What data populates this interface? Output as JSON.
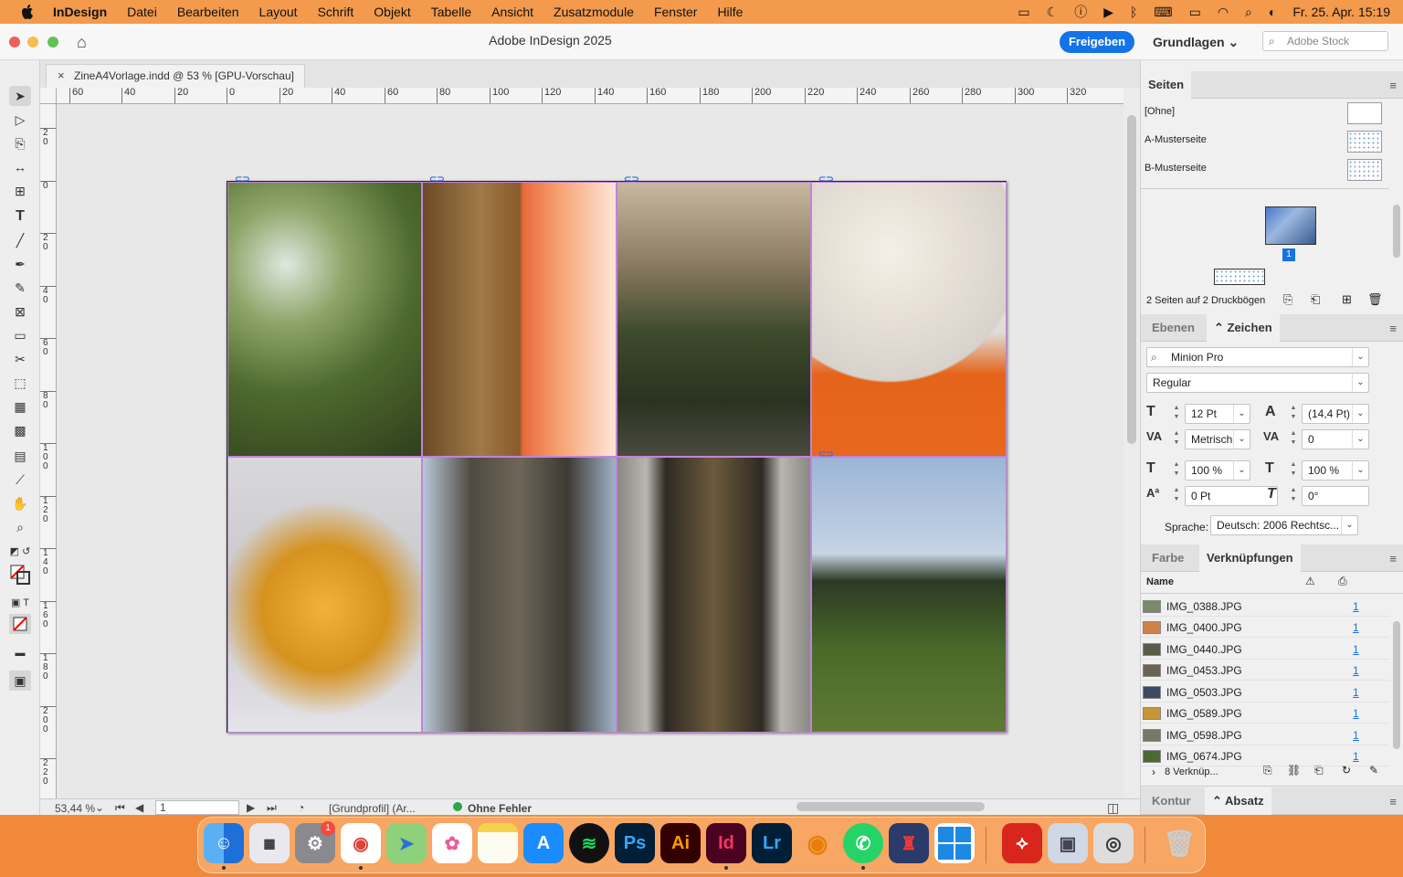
{
  "menubar": {
    "app": "InDesign",
    "items": [
      "Datei",
      "Bearbeiten",
      "Layout",
      "Schrift",
      "Objekt",
      "Tabelle",
      "Ansicht",
      "Zusatzmodule",
      "Fenster",
      "Hilfe"
    ],
    "datetime": "Fr. 25. Apr.  15:19"
  },
  "window": {
    "title": "Adobe InDesign 2025",
    "share_label": "Freigeben",
    "workspace": "Grundlagen",
    "stock_placeholder": "Adobe Stock"
  },
  "document": {
    "tab_label": "ZineA4Vorlage.indd @ 53 % [GPU-Vorschau]"
  },
  "ruler": {
    "h": [
      "60",
      "40",
      "20",
      "0",
      "20",
      "40",
      "60",
      "80",
      "100",
      "120",
      "140",
      "160",
      "180",
      "200",
      "220",
      "240",
      "260",
      "280",
      "300",
      "320"
    ],
    "v": [
      "2\n0",
      "0",
      "2\n0",
      "4\n0",
      "6\n0",
      "8\n0",
      "1\n0\n0",
      "1\n2\n0",
      "1\n4\n0",
      "1\n6\n0",
      "1\n8\n0",
      "2\n0\n0",
      "2\n2\n0"
    ]
  },
  "status": {
    "zoom": "53,44 %",
    "page": "1",
    "profile": "[Grundprofil] (Ar...",
    "errors": "Ohne Fehler"
  },
  "pages_panel": {
    "tab": "Seiten",
    "masters": [
      "[Ohne]",
      "A-Musterseite",
      "B-Musterseite"
    ],
    "page_number": "1",
    "summary": "2 Seiten auf 2 Druckbögen"
  },
  "char_panel": {
    "tabs": [
      "Ebenen",
      "Zeichen"
    ],
    "font": "Minion Pro",
    "style": "Regular",
    "size": "12 Pt",
    "leading": "(14,4 Pt)",
    "kerning": "Metrisch",
    "tracking": "0",
    "vscale": "100 %",
    "hscale": "100 %",
    "baseline": "0 Pt",
    "skew": "0°",
    "language_label": "Sprache:",
    "language": "Deutsch: 2006 Rechtsc..."
  },
  "links_panel": {
    "tabs": [
      "Farbe",
      "Verknüpfungen"
    ],
    "col_name": "Name",
    "rows": [
      {
        "name": "IMG_0388.JPG",
        "page": "1"
      },
      {
        "name": "IMG_0400.JPG",
        "page": "1"
      },
      {
        "name": "IMG_0440.JPG",
        "page": "1"
      },
      {
        "name": "IMG_0453.JPG",
        "page": "1"
      },
      {
        "name": "IMG_0503.JPG",
        "page": "1"
      },
      {
        "name": "IMG_0589.JPG",
        "page": "1"
      },
      {
        "name": "IMG_0598.JPG",
        "page": "1"
      },
      {
        "name": "IMG_0674.JPG",
        "page": "1"
      }
    ],
    "count": "8 Verknüp..."
  },
  "bottom_panel": {
    "tabs": [
      "Kontur",
      "Absatz"
    ]
  },
  "dock": {
    "badge": "1",
    "apps": [
      "finder",
      "launchpad",
      "system-settings",
      "chrome",
      "maps",
      "photos",
      "notes",
      "app-store",
      "spotify",
      "photoshop",
      "illustrator",
      "indesign",
      "lightroom",
      "blender",
      "whatsapp",
      "pixel-app",
      "windows",
      "acrobat",
      "preview",
      "screenshot",
      "trash"
    ],
    "labels": {
      "ps": "Ps",
      "ai": "Ai",
      "id": "Id",
      "lr": "Lr"
    }
  }
}
